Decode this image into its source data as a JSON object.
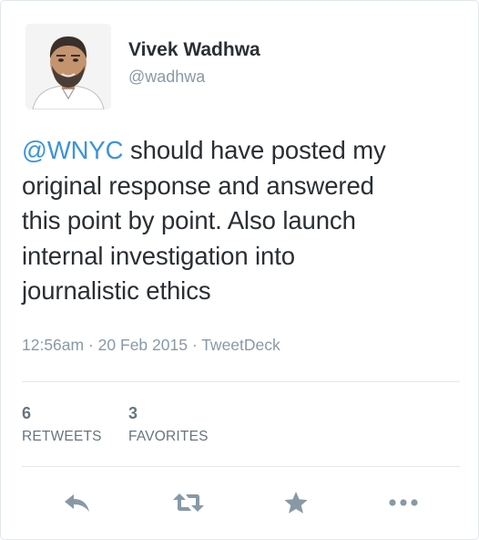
{
  "author": {
    "name": "Vivek Wadhwa",
    "handle": "@wadhwa",
    "avatar_icon": "user-avatar-photo"
  },
  "tweet": {
    "mention": "@WNYC",
    "text_line1_rest": " should have posted my",
    "text_line2": "original response and answered",
    "text_line3": "this point by point. Also launch",
    "text_line4": "internal investigation into",
    "text_line5": "journalistic ethics"
  },
  "meta": {
    "time": "12:56am",
    "separator": " · ",
    "date": "20 Feb 2015",
    "source": "TweetDeck"
  },
  "stats": {
    "retweets_count": "6",
    "retweets_label": "RETWEETS",
    "favorites_count": "3",
    "favorites_label": "FAVORITES"
  },
  "actions": {
    "reply_icon": "reply-icon",
    "retweet_icon": "retweet-icon",
    "favorite_icon": "star-icon",
    "more_icon": "more-icon"
  },
  "colors": {
    "link": "#3b94d9",
    "text": "#292f33",
    "muted": "#8899a6",
    "icon": "#8899a6",
    "border": "#e1e8ed"
  }
}
